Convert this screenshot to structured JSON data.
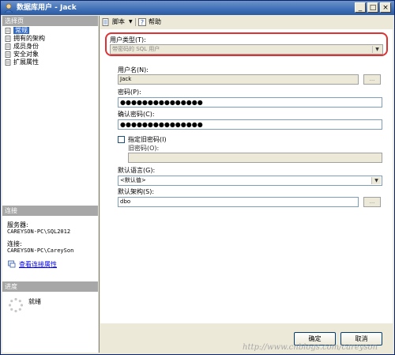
{
  "window": {
    "title": "数据库用户 - Jack",
    "controls": [
      "_",
      "□",
      "×"
    ]
  },
  "left_panel": {
    "select_page_header": "选择页",
    "pages": [
      {
        "label": "常规",
        "icon": "page-icon",
        "selected": true
      },
      {
        "label": "拥有的架构",
        "icon": "page-icon",
        "selected": false
      },
      {
        "label": "成员身份",
        "icon": "page-icon",
        "selected": false
      },
      {
        "label": "安全对象",
        "icon": "page-icon",
        "selected": false
      },
      {
        "label": "扩展属性",
        "icon": "page-icon",
        "selected": false
      }
    ],
    "connection_header": "连接",
    "server_label": "服务器:",
    "server_value": "CAREYSON-PC\\SQL2012",
    "connection_label": "连接:",
    "connection_value": "CAREYSON-PC\\CareySon",
    "view_properties_link": "查看连接属性",
    "progress_header": "进度",
    "progress_status": "就绪"
  },
  "toolbar": {
    "script_label": "脚本",
    "help_label": "帮助"
  },
  "form": {
    "user_type_label": "用户类型(T):",
    "user_type_value": "带密码的 SQL 用户",
    "user_name_label": "用户名(N):",
    "user_name_value": "Jack",
    "password_label": "密码(P):",
    "password_value": "●●●●●●●●●●●●●●●",
    "confirm_password_label": "确认密码(C):",
    "confirm_password_value": "●●●●●●●●●●●●●●●",
    "specify_old_password_label": "指定旧密码(I)",
    "old_password_label": "旧密码(O):",
    "default_language_label": "默认语言(G):",
    "default_language_value": "<默认值>",
    "default_schema_label": "默认架构(S):",
    "default_schema_value": "dbo",
    "ellipsis": "..."
  },
  "buttons": {
    "ok_label": "确定",
    "cancel_label": "取消"
  },
  "watermark": "http://www.cnblogs.com/careyson"
}
